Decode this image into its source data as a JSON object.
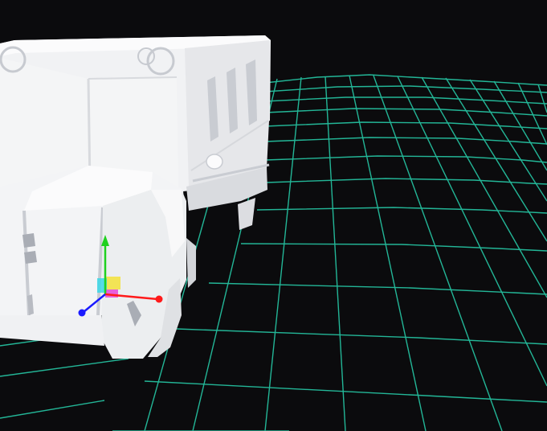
{
  "viewport": {
    "background_color": "#0b0b0d",
    "grid_color": "#26c9a6",
    "model_color": "#f1f2f4",
    "model_shadow_color": "#c9ccd2",
    "model_dark_color": "#a9adb5"
  },
  "transform_gizmo": {
    "x_axis_color": "#ff1a1a",
    "y_axis_color": "#1fd11f",
    "z_axis_color": "#1a1aff",
    "xy_plane_color": "#f5e23a",
    "yz_plane_color": "#3ad7e8",
    "xz_plane_color": "#e83ad7"
  },
  "icons": {
    "gizmo": "move-gizmo-icon",
    "grid": "ground-grid"
  }
}
